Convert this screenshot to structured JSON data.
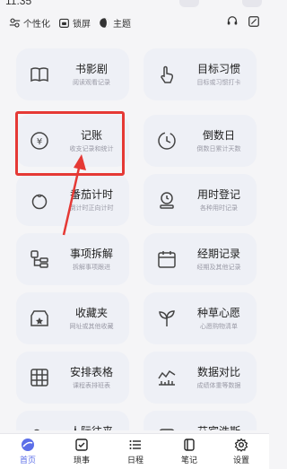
{
  "status": {
    "time": "11:35"
  },
  "topbar": {
    "personalize": "个性化",
    "lockscreen": "锁屏",
    "theme": "主题"
  },
  "cards": [
    {
      "title": "书影剧",
      "sub": "阅读观看记录",
      "icon": "book-icon"
    },
    {
      "title": "目标习惯",
      "sub": "目标或习惯打卡",
      "icon": "hand-tap-icon"
    },
    {
      "title": "记账",
      "sub": "收支记录和统计",
      "icon": "yen-coin-icon"
    },
    {
      "title": "倒数日",
      "sub": "倒数日累计天数",
      "icon": "clock-icon"
    },
    {
      "title": "番茄计时",
      "sub": "倒计时正向计时",
      "icon": "tomato-icon"
    },
    {
      "title": "用时登记",
      "sub": "各种用时记录",
      "icon": "timer-icon"
    },
    {
      "title": "事项拆解",
      "sub": "拆解事项跟进",
      "icon": "breakdown-icon"
    },
    {
      "title": "经期记录",
      "sub": "经期及其他记录",
      "icon": "calendar-icon"
    },
    {
      "title": "收藏夹",
      "sub": "网址或其他收藏",
      "icon": "favorites-icon"
    },
    {
      "title": "种草心愿",
      "sub": "心愿购物清单",
      "icon": "sprout-icon"
    },
    {
      "title": "安排表格",
      "sub": "课程表排班表",
      "icon": "table-icon"
    },
    {
      "title": "数据对比",
      "sub": "成绩体重等数据",
      "icon": "chart-icon"
    },
    {
      "title": "人际往来",
      "sub": "",
      "icon": "people-icon"
    },
    {
      "title": "艾宾浩斯",
      "sub": "",
      "icon": "memory-icon"
    }
  ],
  "tabs": [
    {
      "label": "首页",
      "icon": "home-icon",
      "active": true
    },
    {
      "label": "琐事",
      "icon": "checklist-icon",
      "active": false
    },
    {
      "label": "日程",
      "icon": "schedule-icon",
      "active": false
    },
    {
      "label": "笔记",
      "icon": "note-icon",
      "active": false
    },
    {
      "label": "设置",
      "icon": "gear-icon",
      "active": false
    }
  ],
  "colors": {
    "accent": "#5b6ee8",
    "highlight": "#e53935",
    "card": "#eef0f6"
  }
}
